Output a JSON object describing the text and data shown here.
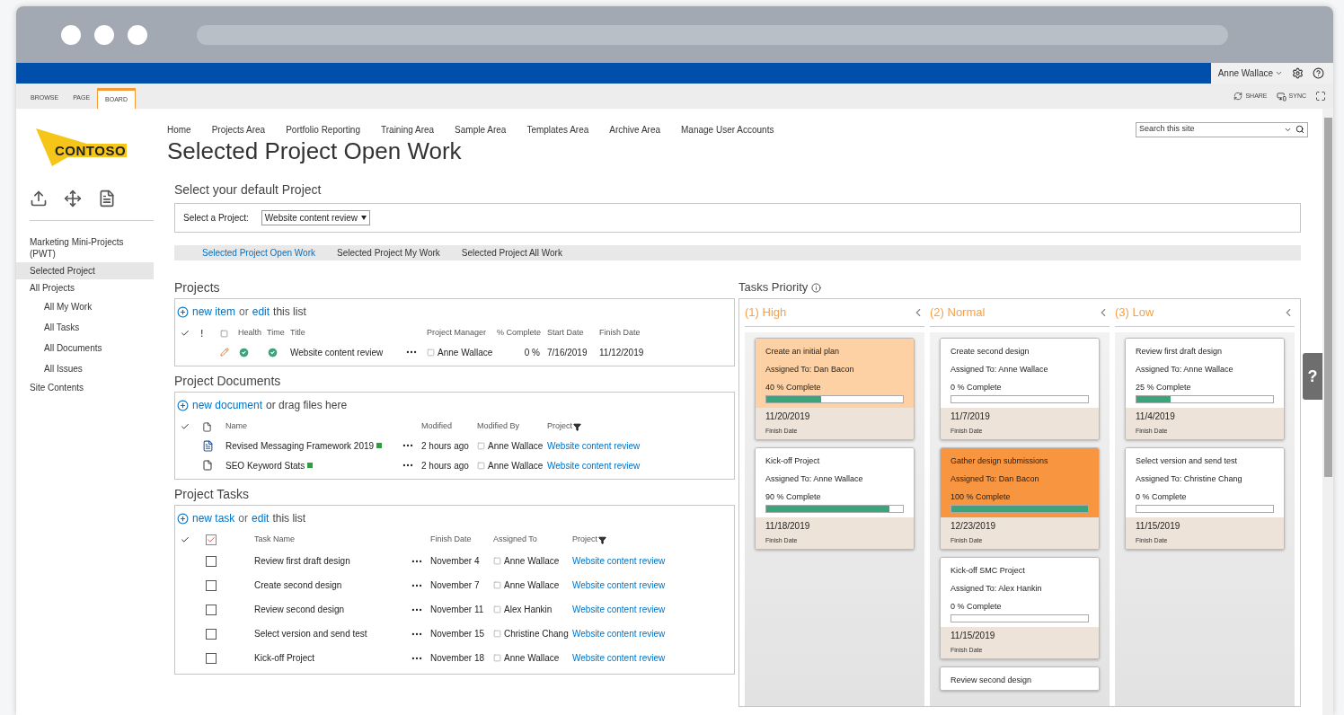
{
  "suite_bar": {
    "user": "Anne Wallace"
  },
  "ribbon": {
    "tabs": [
      {
        "label": "BROWSE",
        "selected": false
      },
      {
        "label": "PAGE",
        "selected": false
      },
      {
        "label": "BOARD",
        "selected": true
      }
    ],
    "actions": [
      "SHARE",
      "SYNC"
    ]
  },
  "logo": "CONTOSO",
  "sidebar": {
    "items": [
      {
        "label": "Marketing Mini-Projects (PWT)",
        "selected": false
      },
      {
        "label": "Selected Project",
        "selected": true
      },
      {
        "label": "All Projects",
        "selected": false,
        "children": [
          {
            "label": "All My Work",
            "selected": false
          },
          {
            "label": "All Tasks",
            "selected": false
          },
          {
            "label": "All Documents",
            "selected": false
          },
          {
            "label": "All Issues",
            "selected": false
          }
        ]
      },
      {
        "label": "Site Contents",
        "selected": false
      }
    ]
  },
  "top_nav": [
    "Home",
    "Projects Area",
    "Portfolio Reporting",
    "Training Area",
    "Sample Area",
    "Templates Area",
    "Archive Area",
    "Manage User Accounts"
  ],
  "search": {
    "placeholder": "Search this site"
  },
  "page_title": "Selected Project Open Work",
  "project_picker": {
    "heading": "Select your default Project",
    "label": "Select a Project:",
    "value": "Website content review"
  },
  "view_tabs": [
    {
      "label": "Selected Project Open Work",
      "selected": true
    },
    {
      "label": "Selected Project My Work",
      "selected": false
    },
    {
      "label": "Selected Project All Work",
      "selected": false
    }
  ],
  "projects": {
    "title": "Projects",
    "toolbar": {
      "link": "new item",
      "or": "or",
      "edit": "edit",
      "tail": "this list"
    },
    "flag_header": "!",
    "columns": [
      "Health",
      "Time",
      "Title",
      "Project Manager",
      "% Complete",
      "Start Date",
      "Finish Date"
    ],
    "rows": [
      {
        "title": "Website content review",
        "manager": "Anne Wallace",
        "complete": "0 %",
        "start": "7/16/2019",
        "finish": "11/12/2019"
      }
    ]
  },
  "documents": {
    "title": "Project Documents",
    "toolbar": {
      "link": "new document",
      "tail": "or drag files here"
    },
    "columns": [
      "Name",
      "Modified",
      "Modified By",
      "Project"
    ],
    "rows": [
      {
        "kind": "word",
        "name": "Revised Messaging Framework 2019",
        "modified": "2 hours ago",
        "modified_by": "Anne Wallace",
        "project": "Website content review"
      },
      {
        "kind": "file",
        "name": "SEO Keyword Stats",
        "modified": "2 hours ago",
        "modified_by": "Anne Wallace",
        "project": "Website content review"
      }
    ]
  },
  "tasks": {
    "title": "Project Tasks",
    "toolbar": {
      "link": "new task",
      "or": "or",
      "edit": "edit",
      "tail": "this list"
    },
    "columns": [
      "Task Name",
      "Finish Date",
      "Assigned To",
      "Project"
    ],
    "rows": [
      {
        "checked": false,
        "name": "Review first draft design",
        "finish": "November 4",
        "assigned": "Anne Wallace",
        "project": "Website content review"
      },
      {
        "checked": false,
        "name": "Create second design",
        "finish": "November 7",
        "assigned": "Anne Wallace",
        "project": "Website content review"
      },
      {
        "checked": false,
        "name": "Review second design",
        "finish": "November 11",
        "assigned": "Alex Hankin",
        "project": "Website content review"
      },
      {
        "checked": false,
        "name": "Select version and send test",
        "finish": "November 15",
        "assigned": "Christine Chang",
        "project": "Website content review"
      },
      {
        "checked": false,
        "name": "Kick-off Project",
        "finish": "November 18",
        "assigned": "Anne Wallace",
        "project": "Website content review"
      }
    ]
  },
  "board": {
    "title": "Tasks Priority",
    "columns": [
      {
        "title": "(1) High",
        "cards": [
          {
            "color": "#fdd1a4",
            "title": "Create an initial plan",
            "assigned": "Assigned To: Dan Bacon",
            "complete": "40 % Complete",
            "level": 0.4,
            "date": "11/20/2019",
            "date_label": "Finish Date"
          },
          {
            "color": "#ffffff",
            "title": "Kick-off Project",
            "assigned": "Assigned To: Anne Wallace",
            "complete": "90 % Complete",
            "level": 0.9,
            "date": "11/18/2019",
            "date_label": "Finish Date"
          }
        ]
      },
      {
        "title": "(2) Normal",
        "cards": [
          {
            "color": "#ffffff",
            "title": "Create second design",
            "assigned": "Assigned To: Anne Wallace",
            "complete": "0 % Complete",
            "level": 0,
            "date": "11/7/2019",
            "date_label": "Finish Date"
          },
          {
            "color": "#f89540",
            "title": "Gather design submissions",
            "assigned": "Assigned To: Dan Bacon",
            "complete": "100 % Complete",
            "level": 1,
            "date": "12/23/2019",
            "date_label": "Finish Date"
          },
          {
            "color": "#ffffff",
            "title": "Kick-off SMC Project",
            "assigned": "Assigned To: Alex Hankin",
            "complete": "0 % Complete",
            "level": 0,
            "date": "11/15/2019",
            "date_label": "Finish Date"
          },
          {
            "color": "#ffffff",
            "title": "Review second design"
          }
        ]
      },
      {
        "title": "(3) Low",
        "cards": [
          {
            "color": "#ffffff",
            "title": "Review first draft design",
            "assigned": "Assigned To: Anne Wallace",
            "complete": "25 % Complete",
            "level": 0.25,
            "date": "11/4/2019",
            "date_label": "Finish Date"
          },
          {
            "color": "#ffffff",
            "title": "Select version and send test",
            "assigned": "Assigned To: Christine Chang",
            "complete": "0 % Complete",
            "level": 0,
            "date": "11/15/2019",
            "date_label": "Finish Date"
          }
        ]
      }
    ]
  },
  "help_tab": "?"
}
